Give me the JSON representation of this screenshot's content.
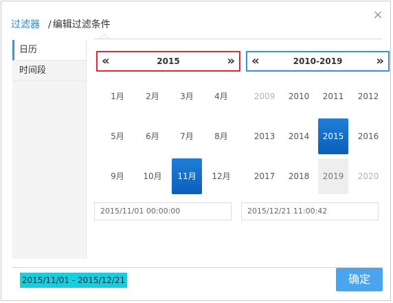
{
  "header": {
    "breadcrumb_root": "过滤器",
    "breadcrumb_sep": "/",
    "breadcrumb_current": "编辑过滤条件"
  },
  "sidebar": {
    "items": [
      {
        "label": "日历",
        "active": true
      },
      {
        "label": "时间段",
        "active": false
      }
    ]
  },
  "left_calendar": {
    "prev": "«",
    "next": "»",
    "title": "2015",
    "months": [
      "1月",
      "2月",
      "3月",
      "4月",
      "5月",
      "6月",
      "7月",
      "8月",
      "9月",
      "10月",
      "11月",
      "12月"
    ],
    "selected": "11月",
    "datetime": "2015/11/01 00:00:00"
  },
  "right_calendar": {
    "prev": "«",
    "next": "»",
    "title": "2010-2019",
    "years": [
      "2009",
      "2010",
      "2011",
      "2012",
      "2013",
      "2014",
      "2015",
      "2016",
      "2017",
      "2018",
      "2019",
      "2020"
    ],
    "selected": "2015",
    "hovered": "2019",
    "muted": [
      "2009",
      "2020"
    ],
    "datetime": "2015/12/21 11:00:42"
  },
  "footer": {
    "range": "2015/11/01 - 2015/12/21",
    "confirm_label": "确定"
  },
  "colors": {
    "accent": "#2d86c9",
    "selected": "#0a5fb9",
    "left_frame": "#e0282e",
    "right_frame": "#3a8fd6",
    "range_badge": "#19cddf"
  }
}
